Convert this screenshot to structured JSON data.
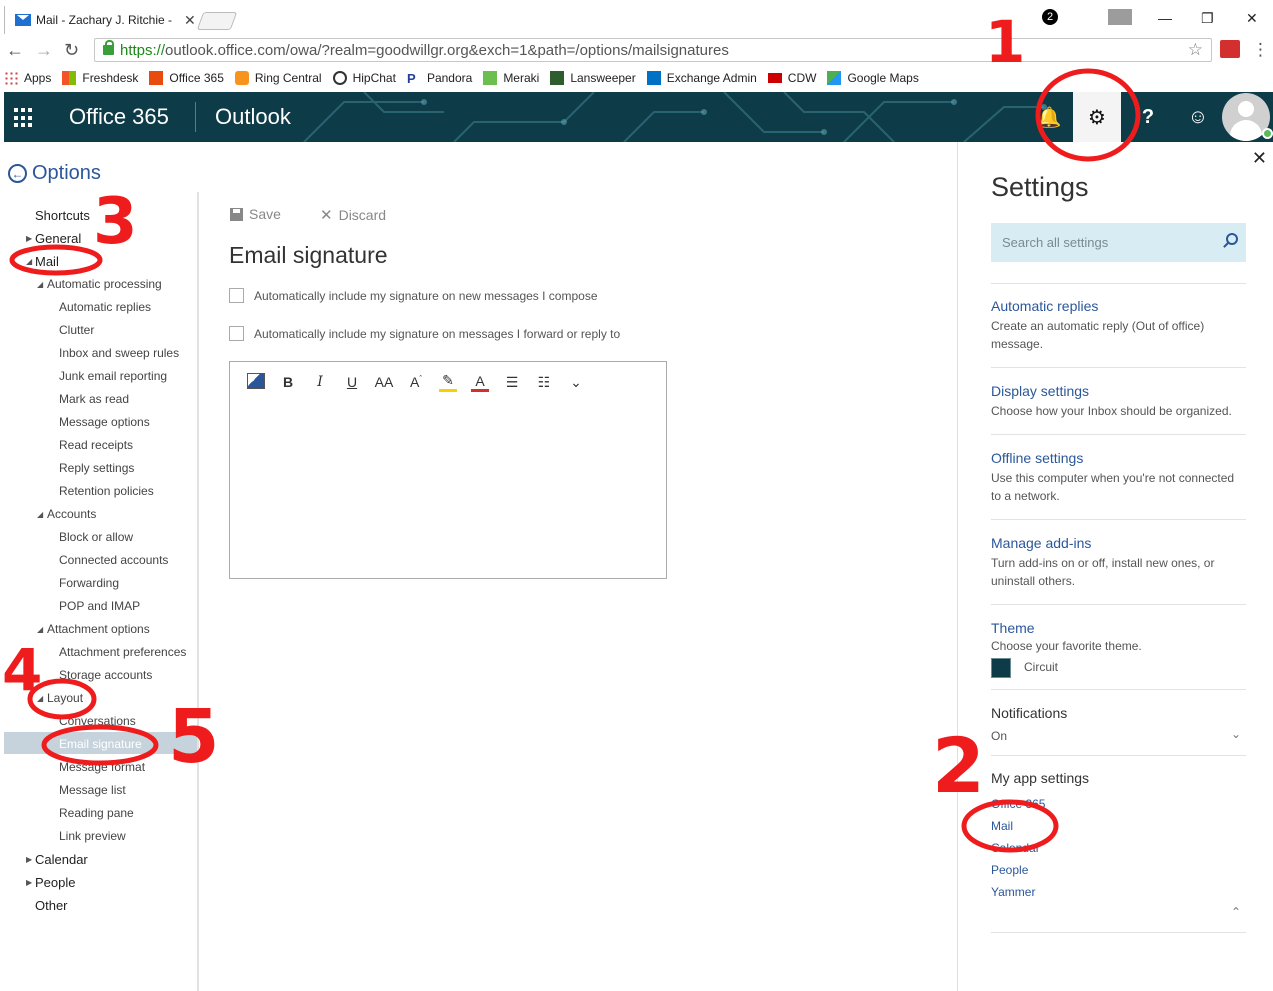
{
  "browser": {
    "tab_title": "Mail - Zachary J. Ritchie -",
    "url_proto": "https://",
    "url_rest": "outlook.office.com/owa/?realm=goodwillgr.org&exch=1&path=/options/mailsignatures",
    "bookmarks": [
      "Apps",
      "Freshdesk",
      "Office 365",
      "Ring Central",
      "HipChat",
      "Pandora",
      "Meraki",
      "Lansweeper",
      "Exchange Admin",
      "CDW",
      "Google Maps"
    ]
  },
  "header": {
    "brand": "Office 365",
    "app": "Outlook",
    "notif_count": "2"
  },
  "left": {
    "title": "Options",
    "items": [
      "Shortcuts",
      "General",
      "Mail",
      "Automatic processing",
      "Automatic replies",
      "Clutter",
      "Inbox and sweep rules",
      "Junk email reporting",
      "Mark as read",
      "Message options",
      "Read receipts",
      "Reply settings",
      "Retention policies",
      "Accounts",
      "Block or allow",
      "Connected accounts",
      "Forwarding",
      "POP and IMAP",
      "Attachment options",
      "Attachment preferences",
      "Storage accounts",
      "Layout",
      "Conversations",
      "Email signature",
      "Message format",
      "Message list",
      "Reading pane",
      "Link preview",
      "Calendar",
      "People",
      "Other"
    ]
  },
  "main": {
    "save": "Save",
    "discard": "Discard",
    "title": "Email signature",
    "check1": "Automatically include my signature on new messages I compose",
    "check2": "Automatically include my signature on messages I forward or reply to"
  },
  "settings": {
    "title": "Settings",
    "search_placeholder": "Search all settings",
    "auto_replies": "Automatic replies",
    "auto_replies_desc": "Create an automatic reply (Out of office) message.",
    "display": "Display settings",
    "display_desc": "Choose how your Inbox should be organized.",
    "offline": "Offline settings",
    "offline_desc": "Use this computer when you're not connected to a network.",
    "addins": "Manage add-ins",
    "addins_desc": "Turn add-ins on or off, install new ones, or uninstall others.",
    "theme": "Theme",
    "theme_desc": "Choose your favorite theme.",
    "theme_value": "Circuit",
    "notifications": "Notifications",
    "notifications_value": "On",
    "my_app": "My app settings",
    "apps": [
      "Office 365",
      "Mail",
      "Calendar",
      "People",
      "Yammer"
    ]
  },
  "annotations": [
    "1",
    "2",
    "3",
    "4",
    "5"
  ]
}
